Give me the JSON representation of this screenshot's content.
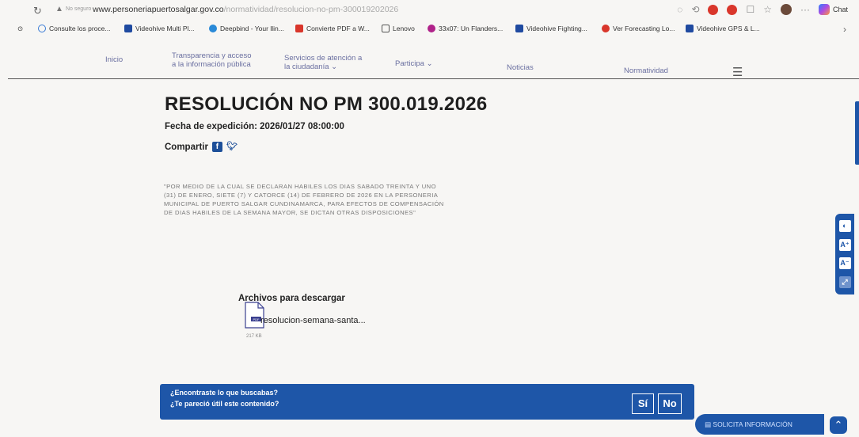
{
  "browser": {
    "not_secure": "No seguro",
    "url_host": "www.personeriapuertosalgar.gov.co",
    "url_path": "/normatividad/resolucion-no-pm-300019202026",
    "chat_label": "Chat",
    "bookmarks": [
      {
        "label": "Consulte los proce...",
        "color": "#3a7bd5"
      },
      {
        "label": "Videohive Multi Pl...",
        "color": "#1f4aa0"
      },
      {
        "label": "Deepbind - Your llin...",
        "color": "#2a8ad8"
      },
      {
        "label": "Convierte PDF a W...",
        "color": "#d9362b"
      },
      {
        "label": "Lenovo",
        "color": "#555555"
      },
      {
        "label": "33x07: Un Flanders...",
        "color": "#b0228a"
      },
      {
        "label": "Videohive Fighting...",
        "color": "#1f4aa0"
      },
      {
        "label": "Ver Forecasting Lo...",
        "color": "#d9362b"
      },
      {
        "label": "Videohive GPS & L...",
        "color": "#1f4aa0"
      }
    ]
  },
  "nav": {
    "inicio": "Inicio",
    "transparencia_1": "Transparencia y acceso",
    "transparencia_2": "a la información pública",
    "servicios_1": "Servicios de atención a",
    "servicios_2": "la ciudadanía ⌄",
    "participa": "Participa ⌄",
    "noticias": "Noticias",
    "normatividad": "Normatividad"
  },
  "content": {
    "title": "RESOLUCIÓN NO PM 300.019.2026",
    "fecha": "Fecha de expedición: 2026/01/27 08:00:00",
    "compartir": "Compartir",
    "description_lines": [
      "\"POR MEDIO DE LA CUAL SE DECLARAN HABILES LOS DIAS SABADO TREINTA Y UNO",
      "(31) DE ENERO, SIETE (7) Y CATORCE (14) DE FEBRERO DE 2026 EN LA PERSONERIA",
      "MUNICIPAL DE PUERTO SALGAR CUNDINAMARCA, PARA EFECTOS DE COMPENSACIÓN",
      "DE DIAS HABILES DE LA SEMANA MAYOR, SE DICTAN OTRAS DISPOSICIONES\""
    ],
    "downloads_title": "Archivos para descargar",
    "file_name": "resolucion-semana-santa...",
    "file_size": "217 KB",
    "file_type": "PDF"
  },
  "a11y": {
    "contrast": "◐",
    "increase": "A⁺",
    "decrease": "A⁻",
    "other": "⤢"
  },
  "feedback": {
    "q1": "¿Encontraste lo que buscabas?",
    "q2": "¿Te pareció útil este contenido?",
    "yes": "Sí",
    "no": "No"
  },
  "solicita": "SOLICITA INFORMACIÓN",
  "colors": {
    "brand_blue": "#1e56a8",
    "nav_text": "#6a6fa0"
  }
}
